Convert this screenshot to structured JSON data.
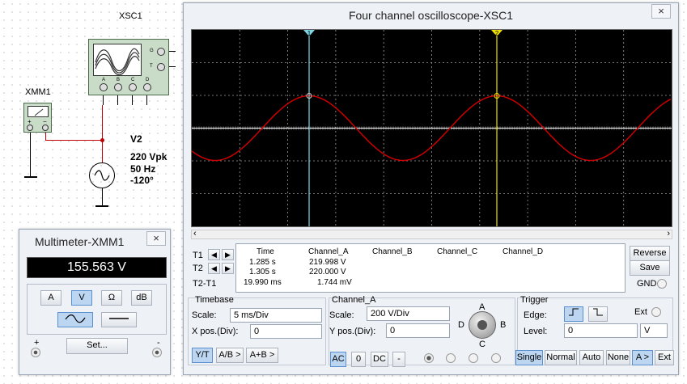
{
  "schematic": {
    "xsc1_label": "XSC1",
    "xsc1_terminals": [
      "A",
      "B",
      "C",
      "D"
    ],
    "xsc1_side_terminals": [
      "G",
      "T"
    ],
    "xmm1_label": "XMM1",
    "v2": {
      "name": "V2",
      "amplitude": "220 Vpk",
      "frequency": "50 Hz",
      "phase": "-120°"
    }
  },
  "multimeter": {
    "title": "Multimeter-XMM1",
    "display": "155.563 V",
    "modes": [
      "A",
      "V",
      "Ω",
      "dB"
    ],
    "active_mode": "V",
    "set_label": "Set...",
    "plus": "+",
    "minus": "-",
    "close": "×"
  },
  "scope": {
    "title": "Four channel oscilloscope-XSC1",
    "close": "×",
    "cursor1_label": "1",
    "cursor2_label": "2",
    "trace_color": "#cc0000",
    "readout": {
      "headers": [
        "Time",
        "Channel_A",
        "Channel_B",
        "Channel_C",
        "Channel_D"
      ],
      "row_labels": [
        "T1",
        "T2",
        "T2-T1"
      ],
      "time": [
        "1.285 s",
        "1.305 s",
        "19.990 ms"
      ],
      "channel_a": [
        "219.998 V",
        "220.000 V",
        "1.744 mV"
      ]
    },
    "reverse_label": "Reverse",
    "save_label": "Save",
    "gnd_label": "GND",
    "timebase": {
      "title": "Timebase",
      "scale_label": "Scale:",
      "scale_value": "5 ms/Div",
      "xpos_label": "X pos.(Div):",
      "xpos_value": "0",
      "modes": [
        "Y/T",
        "A/B >",
        "A+B >"
      ]
    },
    "channel": {
      "title": "Channel_A",
      "scale_label": "Scale:",
      "scale_value": "200  V/Div",
      "ypos_label": "Y pos.(Div):",
      "ypos_value": "0",
      "coupling": [
        "AC",
        "0",
        "DC",
        "-"
      ],
      "knob_labels": [
        "A",
        "B",
        "C",
        "D"
      ]
    },
    "trigger": {
      "title": "Trigger",
      "edge_label": "Edge:",
      "ext_label": "Ext",
      "level_label": "Level:",
      "level_value": "0",
      "level_unit": "V",
      "modes": [
        "Single",
        "Normal",
        "Auto",
        "None",
        "A >",
        "Ext"
      ]
    }
  }
}
